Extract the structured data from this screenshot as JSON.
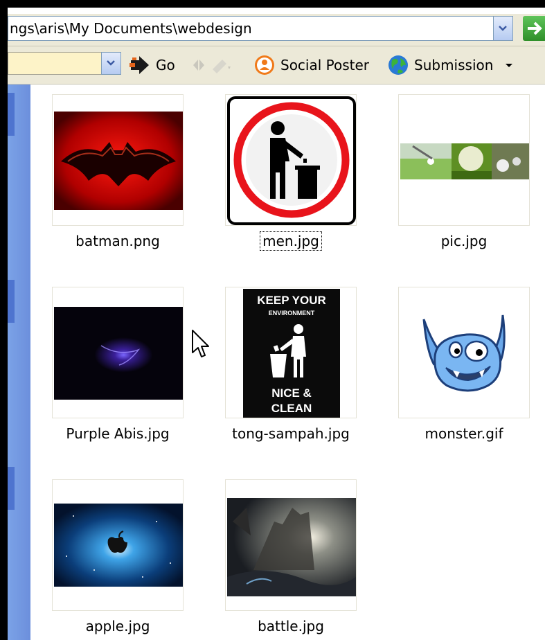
{
  "address": {
    "path": "ngs\\aris\\My Documents\\webdesign"
  },
  "toolbar": {
    "go_label": "Go",
    "social_poster_label": "Social Poster",
    "submission_label": "Submission"
  },
  "files": [
    {
      "name": "batman.png",
      "selected": false
    },
    {
      "name": "men.jpg",
      "selected": true
    },
    {
      "name": "pic.jpg",
      "selected": false
    },
    {
      "name": "Purple Abis.jpg",
      "selected": false
    },
    {
      "name": "tong-sampah.jpg",
      "selected": false
    },
    {
      "name": "monster.gif",
      "selected": false
    },
    {
      "name": "apple.jpg",
      "selected": false
    },
    {
      "name": "battle.jpg",
      "selected": false
    }
  ],
  "tong_sampah_sign": {
    "line1": "KEEP YOUR",
    "line2": "ENVIRONMENT",
    "line3": "NICE &",
    "line4": "CLEAN"
  },
  "colors": {
    "xp_blue_panel": "#7ba2e7",
    "toolbar_bg": "#ece9d8",
    "search_bg": "#fdf3c8",
    "go_green": "#3a9e34"
  }
}
